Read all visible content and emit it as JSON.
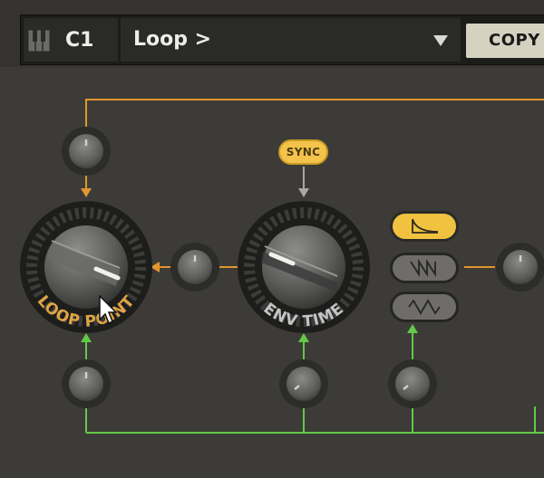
{
  "header": {
    "note": "C1",
    "preset": "Loop >",
    "copy_label": "COPY"
  },
  "sync": {
    "label": "SYNC"
  },
  "knobs": {
    "loop_point": {
      "label": "LOOP POINT"
    },
    "env_time": {
      "label": "ENV TIME"
    }
  },
  "waveforms": [
    "decay",
    "saw",
    "triangle"
  ],
  "colors": {
    "panel": "#3d3b37",
    "orange_line": "#e2952e",
    "green_line": "#63c948",
    "accent_yellow": "#f4c34b",
    "label_gold": "#e0a544",
    "label_grey": "#c4c4c4"
  }
}
